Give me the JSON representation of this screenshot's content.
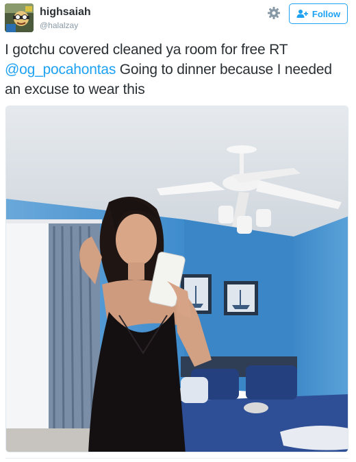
{
  "user": {
    "display_name": "highsaiah",
    "handle": "@halalzay",
    "avatar_icon": "cartoon-avatar-icon"
  },
  "actions": {
    "settings_icon": "gear-icon",
    "follow_icon": "add-user-icon",
    "follow_label": "Follow"
  },
  "tweet": {
    "text_before_mention": "I gotchu covered cleaned ya room for free RT ",
    "mention": "@og_pocahontas",
    "text_after_mention": " Going to dinner because I needed an excuse to wear this"
  },
  "colors": {
    "accent": "#1da1f2",
    "text": "#292f33",
    "muted": "#8899a6",
    "wall": "#4a9ad6"
  }
}
